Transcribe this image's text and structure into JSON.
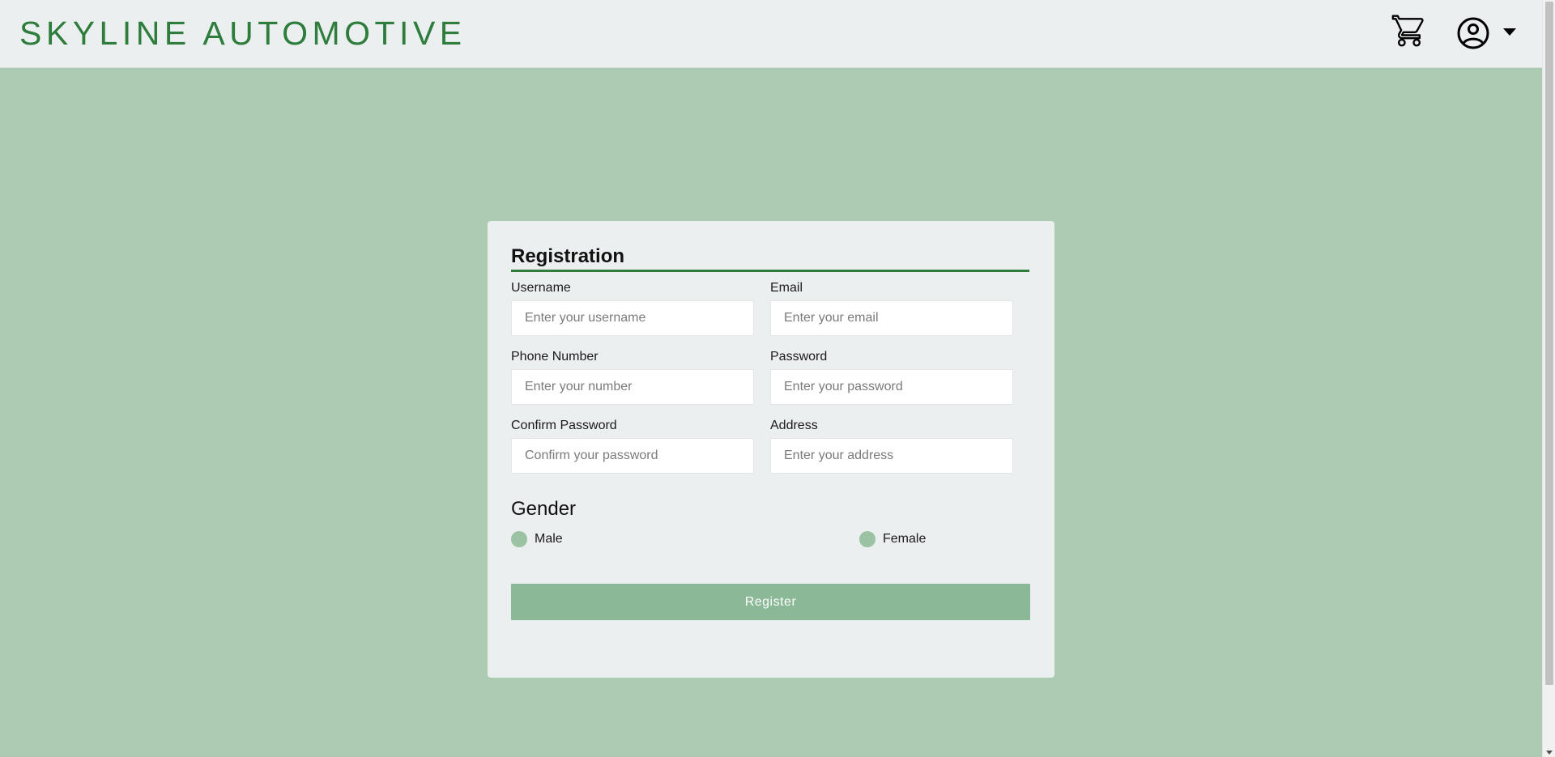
{
  "header": {
    "brand": "SKYLINE AUTOMOTIVE",
    "cart_icon": "cart-icon",
    "user_icon": "user-circle-icon",
    "dropdown_icon": "caret-down-icon"
  },
  "form": {
    "title": "Registration",
    "fields": {
      "username": {
        "label": "Username",
        "placeholder": "Enter your username",
        "value": ""
      },
      "email": {
        "label": "Email",
        "placeholder": "Enter your email",
        "value": ""
      },
      "phone": {
        "label": "Phone Number",
        "placeholder": "Enter your number",
        "value": ""
      },
      "password": {
        "label": "Password",
        "placeholder": "Enter your password",
        "value": ""
      },
      "confirm_password": {
        "label": "Confirm Password",
        "placeholder": "Confirm your password",
        "value": ""
      },
      "address": {
        "label": "Address",
        "placeholder": "Enter your address",
        "value": ""
      }
    },
    "gender": {
      "heading": "Gender",
      "options": [
        "Male",
        "Female"
      ],
      "selected": null
    },
    "submit_label": "Register"
  },
  "colors": {
    "brand": "#2e7d3d",
    "page_background": "#abccb3",
    "panel": "#eceff0",
    "button": "#8bb897",
    "radio": "#9cc2a4"
  }
}
